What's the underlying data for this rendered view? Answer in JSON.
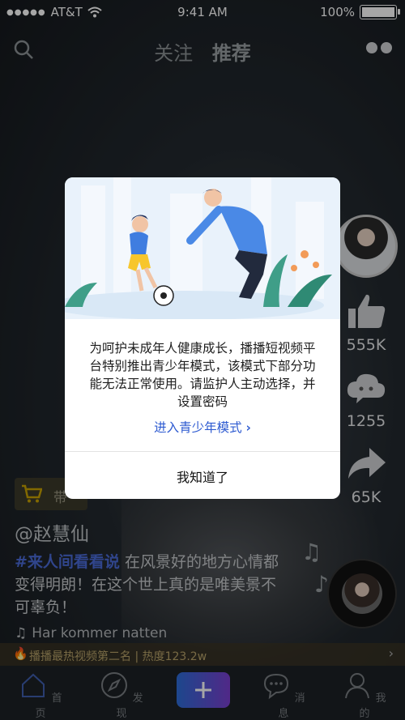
{
  "status_bar": {
    "carrier": "AT&T",
    "time": "9:41 AM",
    "battery": "100%"
  },
  "top_nav": {
    "tabs": [
      {
        "label": "关注"
      },
      {
        "label": "推荐"
      }
    ]
  },
  "rail": {
    "likes": "555K",
    "comments": "1255",
    "shares": "65K"
  },
  "shop": {
    "label": "带"
  },
  "caption": {
    "author": "@赵慧仙",
    "tag": "#来人间看看说",
    "text": " 在风景好的地方心情都变得明朗！在这个世上真的是唯美景不可辜负！",
    "music": "Har kommer natten"
  },
  "banner": {
    "text": "播播最热视频第二名 | 热度123.2w"
  },
  "tabbar": {
    "items": [
      {
        "label": "首页"
      },
      {
        "label": "发现"
      },
      {
        "label": "消息"
      },
      {
        "label": "我的"
      }
    ]
  },
  "modal": {
    "message": "为呵护未成年人健康成长，播播短视频平台特别推出青少年模式，该模式下部分功能无法正常使用。请监护人主动选择，并设置密码",
    "link": "进入青少年模式",
    "confirm": "我知道了"
  },
  "colors": {
    "accent": "#2e5bd1",
    "plus_start": "#2d6dd9",
    "plus_end": "#7c3fd1"
  }
}
